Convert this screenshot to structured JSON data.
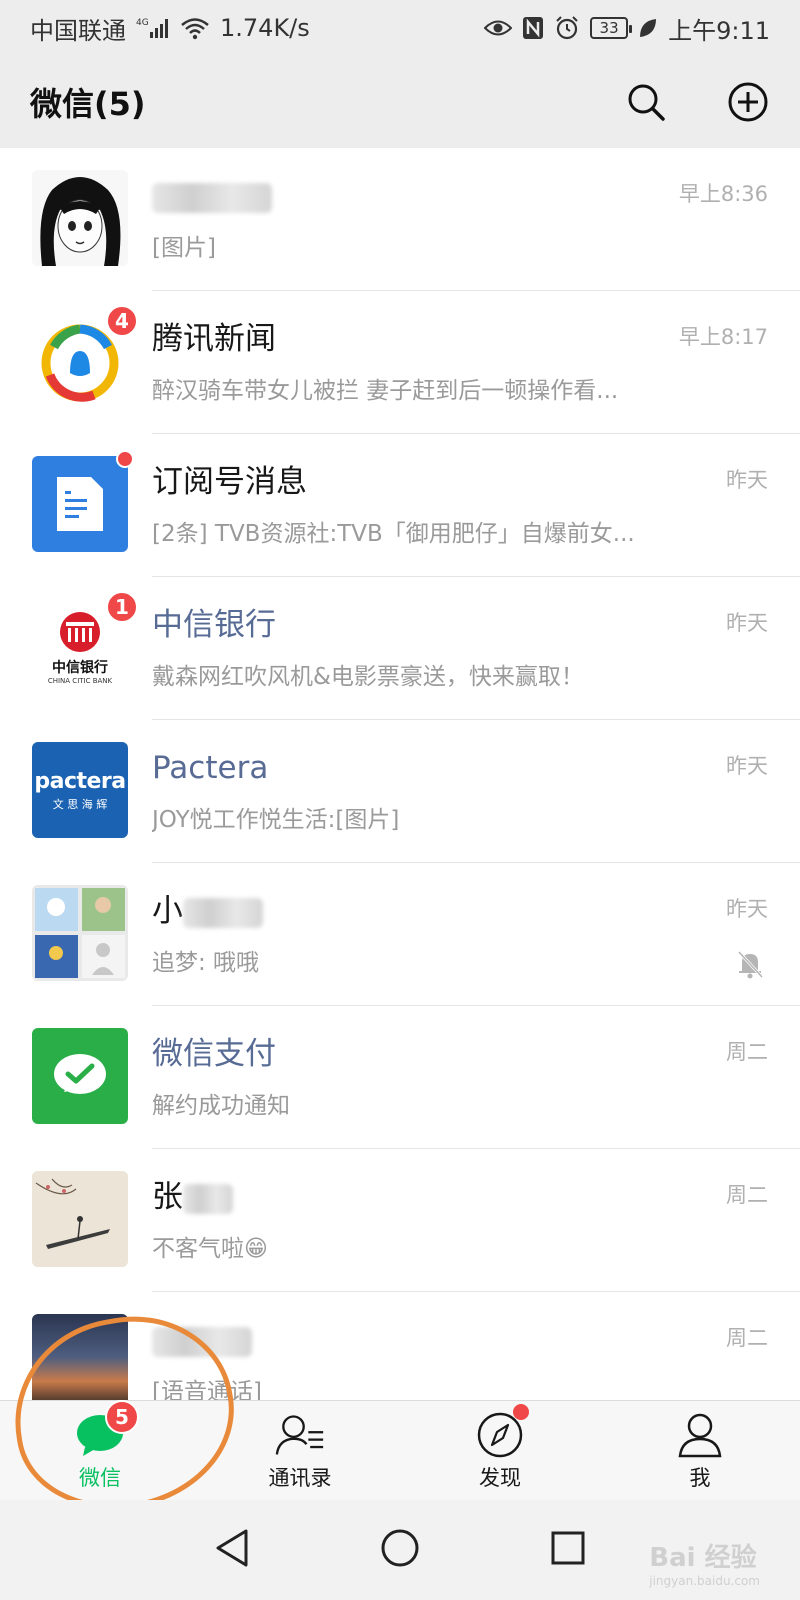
{
  "status_bar": {
    "carrier": "中国联通",
    "network": "4G",
    "speed": "1.74K/s",
    "battery": "33",
    "time": "上午9:11"
  },
  "header": {
    "title": "微信(5)",
    "search_icon": "search-icon",
    "add_icon": "plus-circle-icon"
  },
  "chats": [
    {
      "name": "",
      "preview": "[图片]",
      "time": "早上8:36",
      "avatar": "anime-girl-sketch"
    },
    {
      "name": "腾讯新闻",
      "preview": "醉汉骑车带女儿被拦 妻子赶到后一顿操作看...",
      "time": "早上8:17",
      "badge": "4",
      "avatar": "tencent-news-logo"
    },
    {
      "name": "订阅号消息",
      "preview": "[2条] TVB资源社:TVB「御用肥仔」自爆前女...",
      "time": "昨天",
      "avatar": "subscription-icon"
    },
    {
      "name": "中信银行",
      "preview": "戴森网红吹风机&电影票豪送，快来赢取！",
      "time": "昨天",
      "badge": "1",
      "avatar": "citic-bank-logo",
      "brand_text": "中信银行",
      "brand_sub": "CHINA CITIC BANK"
    },
    {
      "name": "Pactera",
      "preview": "JOY悦工作悦生活:[图片]",
      "time": "昨天",
      "avatar": "pactera-logo",
      "brand_text": "pactera",
      "brand_sub": "文 思 海 辉"
    },
    {
      "name": "小",
      "preview": "追梦: 哦哦",
      "time": "昨天",
      "avatar": "group-avatar",
      "muted": true
    },
    {
      "name": "微信支付",
      "preview": "解约成功通知",
      "time": "周二",
      "avatar": "wechat-pay-logo"
    },
    {
      "name": "张",
      "preview": "不客气啦😁",
      "time": "周二",
      "avatar": "ink-painting-boat"
    },
    {
      "name": "",
      "preview": "[语音通话]",
      "time": "周二",
      "avatar": "sunset-photo"
    }
  ],
  "tabs": [
    {
      "label": "微信",
      "badge": "5",
      "active": true
    },
    {
      "label": "通讯录"
    },
    {
      "label": "发现",
      "dot": true
    },
    {
      "label": "我"
    }
  ],
  "watermark": {
    "title": "Bai 经验",
    "sub": "jingyan.baidu.com"
  },
  "colors": {
    "accent": "#07c160",
    "badge": "#f04848",
    "link": "#576b95",
    "annotation": "#e88a3a"
  }
}
